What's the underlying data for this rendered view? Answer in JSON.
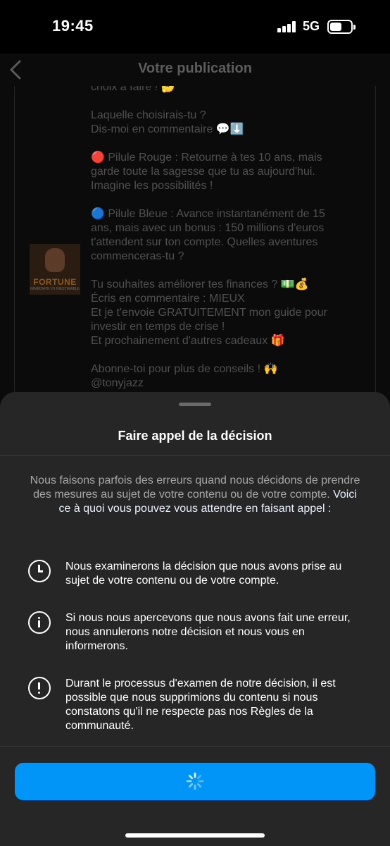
{
  "status_bar": {
    "time": "19:45",
    "network": "5G",
    "signal_icon": "signal-bars-icon",
    "battery_icon": "battery-icon",
    "battery_level": 0.5
  },
  "header": {
    "back_icon": "chevron-left-icon",
    "title": "Votre publication"
  },
  "post": {
    "thumbnail_logo": "FORTUNE",
    "thumbnail_subtitle": "IMMÉDIATE VS INESTIMABLE",
    "caption_lines": [
      "choix à faire ! 🤔",
      "",
      "Laquelle choisirais-tu ?",
      "Dis-moi en commentaire 💬⬇️",
      "",
      "🔴 Pilule Rouge : Retourne à tes 10 ans, mais",
      "garde toute la sagesse que tu as aujourd'hui.",
      "Imagine les possibilités !",
      "",
      "🔵 Pilule Bleue : Avance instantanément de 15",
      "ans, mais avec un bonus : 150 millions d'euros",
      "t'attendent sur ton compte. Quelles aventures",
      "commenceras-tu ?",
      "",
      "Tu souhaites améliorer tes finances ? 💵💰",
      "Écris en commentaire : MIEUX",
      "Et je t'envoie GRATUITEMENT mon guide pour",
      "investir en temps de crise !",
      "Et prochainement d'autres cadeaux 🎁",
      "",
      "Abonne-toi pour plus de conseils ! 🙌",
      "@tonyjazz"
    ]
  },
  "sheet": {
    "title": "Faire appel de la décision",
    "intro_text": "Nous faisons parfois des erreurs quand nous décidons de prendre des mesures au sujet de votre contenu ou de votre compte.",
    "intro_link": "Voici ce à quoi vous pouvez vous attendre en faisant appel :",
    "items": [
      {
        "icon": "clock-icon",
        "text": "Nous examinerons la décision que nous avons prise au sujet de votre contenu ou de votre compte."
      },
      {
        "icon": "info-icon",
        "text": "Si nous nous apercevons que nous avons fait une erreur, nous annulerons notre décision et nous vous en informerons."
      },
      {
        "icon": "alert-icon",
        "text": "Durant le processus d'examen de notre décision, il est possible que nous supprimions du contenu si nous constatons qu'il ne respecte pas nos Règles de la communauté."
      }
    ],
    "button_icon": "loading-spinner-icon",
    "button_color": "#0095f6"
  }
}
